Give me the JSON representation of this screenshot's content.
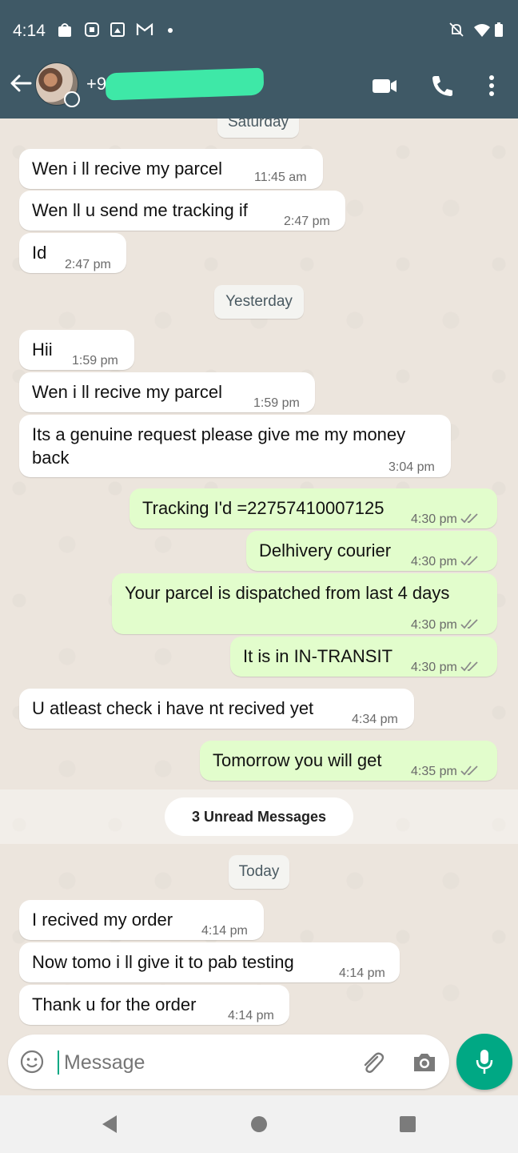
{
  "status_bar": {
    "time": "4:14",
    "icons": [
      "shopping-bag-icon",
      "app-icon",
      "gallery-icon",
      "gmail-icon",
      "dot-icon",
      "notifications-muted-icon",
      "wifi-icon",
      "battery-icon"
    ]
  },
  "header": {
    "contact_number": "+91",
    "icons": [
      "back-arrow-icon",
      "video-call-icon",
      "voice-call-icon",
      "more-options-icon"
    ]
  },
  "chat": {
    "date_saturday": "Saturday",
    "date_yesterday": "Yesterday",
    "date_today": "Today",
    "unread_banner": "3 Unread Messages",
    "messages": [
      {
        "direction": "in",
        "text": "Wen i ll recive my parcel",
        "time": "11:45 am"
      },
      {
        "direction": "in",
        "text": "Wen ll u send me tracking if",
        "time": "2:47 pm"
      },
      {
        "direction": "in",
        "text": "Id",
        "time": "2:47 pm"
      },
      {
        "direction": "in",
        "text": "Hii",
        "time": "1:59 pm"
      },
      {
        "direction": "in",
        "text": "Wen i ll recive my parcel",
        "time": "1:59 pm"
      },
      {
        "direction": "in",
        "text": "Its a genuine request please give me my money\nback",
        "time": "3:04 pm"
      },
      {
        "direction": "out",
        "text": "Tracking I'd =22757410007125",
        "time": "4:30 pm"
      },
      {
        "direction": "out",
        "text": "Delhivery courier",
        "time": "4:30 pm"
      },
      {
        "direction": "out",
        "text": "Your parcel is dispatched from last 4 days",
        "time": "4:30 pm"
      },
      {
        "direction": "out",
        "text": "It is in IN-TRANSIT",
        "time": "4:30 pm"
      },
      {
        "direction": "in",
        "text": "U atleast check i have nt recived yet",
        "time": "4:34 pm"
      },
      {
        "direction": "out",
        "text": "Tomorrow you will get",
        "time": "4:35 pm"
      },
      {
        "direction": "in",
        "text": "I recived my order",
        "time": "4:14 pm"
      },
      {
        "direction": "in",
        "text": "Now tomo i ll give it to pab testing",
        "time": "4:14 pm"
      },
      {
        "direction": "in",
        "text": "Thank u for the order",
        "time": "4:14 pm"
      }
    ]
  },
  "composer": {
    "placeholder": "Message",
    "icons": [
      "emoji-icon",
      "attach-icon",
      "camera-icon",
      "microphone-icon"
    ]
  },
  "colors": {
    "header": "#3f5966",
    "incoming": "#ffffff",
    "outgoing": "#e2fdcc",
    "accent": "#00a884",
    "read_ticks": "#8a8a8a"
  }
}
